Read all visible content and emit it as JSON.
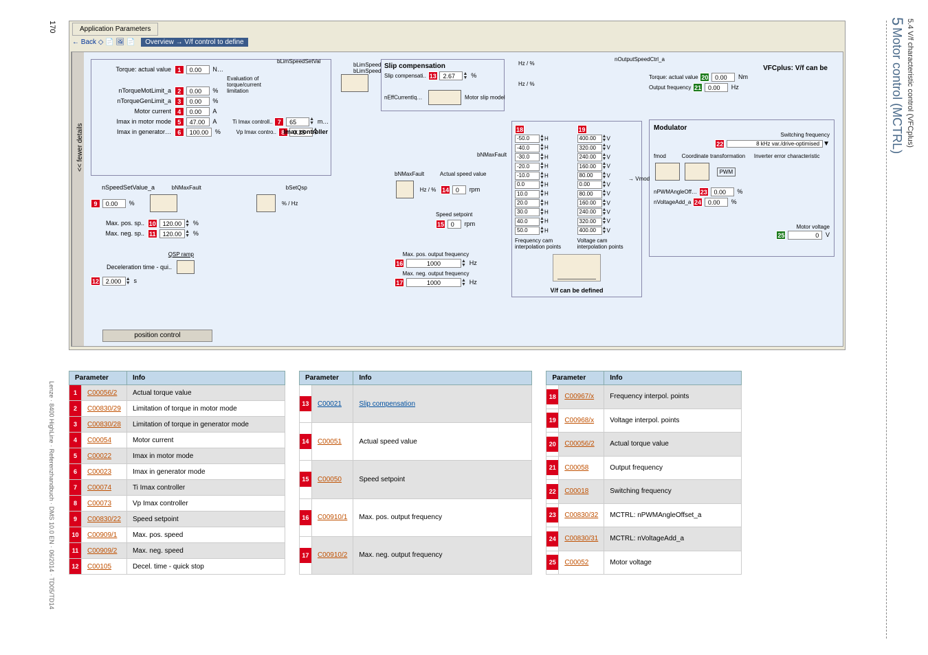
{
  "page_number": "170",
  "footer": "Lenze · 8400 HighLine · Referenzhandbuch · DMS 10.0 EN · 06/2014 · TD05/TD14",
  "chapter": {
    "num": "5",
    "title": "Motor control (MCTRL)"
  },
  "section": {
    "num": "5.4",
    "title": "V/f characteristic control (VFCplus)"
  },
  "tab": "Application Parameters",
  "toolbar": {
    "back": "← Back",
    "icons": "◇  📄 🖼 📄",
    "breadcrumb": "Overview → V/f control to define"
  },
  "fewer_details": "<< fewer details",
  "left_group": {
    "torque_actual": {
      "label": "Torque: actual value",
      "badge": "1",
      "value": "0.00",
      "unit": "N…"
    },
    "ntorquemot": {
      "label": "nTorqueMotLimit_a",
      "badge": "2",
      "value": "0.00",
      "unit": "%"
    },
    "ntorquegen": {
      "label": "nTorqueGenLimit_a",
      "badge": "3",
      "value": "0.00",
      "unit": "%"
    },
    "motor_current": {
      "label": "Motor current",
      "badge": "4",
      "value": "0.00",
      "unit": "A"
    },
    "imax_motor": {
      "label": "Imax in motor mode",
      "badge": "5",
      "value": "47.00",
      "unit": "A"
    },
    "imax_gen": {
      "label": "Imax in generator…",
      "badge": "6",
      "value": "100.00",
      "unit": "%"
    },
    "eval_label": "Evaluation of torque/current limitation",
    "ti_imax": {
      "label": "Ti Imax controll..",
      "badge": "7",
      "value": "65",
      "unit": "m…"
    },
    "vp_imax": {
      "label": "Vp Imax contro..",
      "badge": "8",
      "value": "0.25"
    },
    "imax_title": "Imax controller",
    "blimspeed": "bLimSpeedSetVal",
    "blim_setval": "bLimSpeedSetVal\nbLimSpeedSet Out"
  },
  "setvalue": {
    "nspeed": {
      "label": "nSpeedSetValue_a",
      "badge": "9",
      "value": "0.00",
      "unit": "%"
    },
    "bnmax": "bNMaxFault",
    "bsetqsp": "bSetQsp",
    "max_pos_sp": {
      "label": "Max. pos. sp..",
      "badge": "10",
      "value": "120.00",
      "unit": "%"
    },
    "max_neg_sp": {
      "label": "Max. neg. sp..",
      "badge": "11",
      "value": "120.00",
      "unit": "%"
    },
    "qsp_label": "QSP ramp",
    "decel": {
      "label": "Deceleration time - qui..",
      "badge": "12",
      "value": "2.000",
      "unit": "s"
    }
  },
  "slip": {
    "title": "Slip compensation",
    "comp": {
      "label": "Slip compensati..",
      "badge": "13",
      "value": "2.67",
      "unit": "%"
    },
    "neffcurrent": "nEffCurrentIq…",
    "motor_slip": "Motor slip model",
    "bnmax_fault": "bNMaxFault",
    "hz_pct": "Hz / %"
  },
  "actual_speed": {
    "bnmax": "bNMaxFault",
    "title": "Actual speed value",
    "badge14": "14",
    "value14": "0",
    "unit14": "rpm",
    "setpoint_title": "Speed setpoint",
    "badge15": "15",
    "value15": "0",
    "unit15": "rpm"
  },
  "max_freq": {
    "pos_label": "Max. pos. output frequency",
    "badge16": "16",
    "value16": "1000",
    "unit": "Hz",
    "neg_label": "Max. neg. output frequency",
    "badge17": "17",
    "value17": "1000"
  },
  "vf": {
    "badge18": "18",
    "badge19": "19",
    "hz_values": [
      "-50.0",
      "-40.0",
      "-30.0",
      "-20.0",
      "-10.0",
      "0.0",
      "10.0",
      "20.0",
      "30.0",
      "40.0",
      "50.0"
    ],
    "v_values": [
      "400.00",
      "320.00",
      "240.00",
      "160.00",
      "80.00",
      "0.00",
      "80.00",
      "160.00",
      "240.00",
      "320.00",
      "400.00"
    ],
    "freq_cam": "Frequency cam interpolation points",
    "volt_cam": "Voltage cam interpolation points",
    "bottom": "V/f can be defined",
    "H": "H",
    "V": "V"
  },
  "right": {
    "noutput": "nOutputSpeedCtrl_a",
    "vfc_title": "VFCplus: V/f can be",
    "torque_actual": {
      "label": "Torque: actual value",
      "badge": "20",
      "value": "0.00",
      "unit": "Nm"
    },
    "output_freq": {
      "label": "Output frequency",
      "badge": "21",
      "value": "0.00",
      "unit": "Hz"
    },
    "modulator": "Modulator",
    "sw_freq_label": "Switching frequency",
    "sw_freq_badge": "22",
    "sw_freq_value": "8 kHz var./drive-optimised",
    "fmod": "fmod",
    "coord": "Coordinate transformation",
    "inverter": "Inverter error characteristic",
    "pwm": "PWM",
    "npwm": {
      "label": "nPWMAngleOff…",
      "badge": "23",
      "value": "0.00",
      "unit": "%"
    },
    "nvolt": {
      "label": "nVoltageAdd_a",
      "badge": "24",
      "value": "0.00",
      "unit": "%"
    },
    "vmod": "Vmod",
    "motor_voltage_label": "Motor voltage",
    "motor_voltage_badge": "25",
    "motor_voltage_value": "0",
    "motor_voltage_unit": "V"
  },
  "position_control": "position control",
  "tables": {
    "headers": {
      "parameter": "Parameter",
      "info": "Info"
    },
    "t1": [
      {
        "n": "1",
        "code": "C00056/2",
        "info": "Actual torque value",
        "odd": true
      },
      {
        "n": "2",
        "code": "C00830/29",
        "info": "Limitation of torque in motor mode"
      },
      {
        "n": "3",
        "code": "C00830/28",
        "info": "Limitation of torque in generator mode",
        "odd": true
      },
      {
        "n": "4",
        "code": "C00054",
        "info": "Motor current"
      },
      {
        "n": "5",
        "code": "C00022",
        "info": "Imax in motor mode",
        "odd": true
      },
      {
        "n": "6",
        "code": "C00023",
        "info": "Imax in generator mode"
      },
      {
        "n": "7",
        "code": "C00074",
        "info": "Ti Imax controller",
        "odd": true
      },
      {
        "n": "8",
        "code": "C00073",
        "info": "Vp Imax controller"
      },
      {
        "n": "9",
        "code": "C00830/22",
        "info": "Speed setpoint",
        "odd": true
      },
      {
        "n": "10",
        "code": "C00909/1",
        "info": "Max. pos. speed"
      },
      {
        "n": "11",
        "code": "C00909/2",
        "info": "Max. neg. speed",
        "odd": true
      },
      {
        "n": "12",
        "code": "C00105",
        "info": "Decel. time - quick stop"
      }
    ],
    "t2": [
      {
        "n": "13",
        "code": "C00021",
        "info": "Slip compensation",
        "odd": true,
        "blue": true
      },
      {
        "n": "14",
        "code": "C00051",
        "info": "Actual speed value"
      },
      {
        "n": "15",
        "code": "C00050",
        "info": "Speed setpoint",
        "odd": true
      },
      {
        "n": "16",
        "code": "C00910/1",
        "info": "Max. pos. output frequency"
      },
      {
        "n": "17",
        "code": "C00910/2",
        "info": "Max. neg. output frequency",
        "odd": true
      }
    ],
    "t3": [
      {
        "n": "18",
        "code": "C00967/x",
        "info": "Frequency interpol. points",
        "odd": true
      },
      {
        "n": "19",
        "code": "C00968/x",
        "info": "Voltage interpol. points"
      },
      {
        "n": "20",
        "code": "C00056/2",
        "info": "Actual torque value",
        "odd": true
      },
      {
        "n": "21",
        "code": "C00058",
        "info": "Output frequency"
      },
      {
        "n": "22",
        "code": "C00018",
        "info": "Switching frequency",
        "odd": true
      },
      {
        "n": "23",
        "code": "C00830/32",
        "info": "MCTRL: nPWMAngleOffset_a"
      },
      {
        "n": "24",
        "code": "C00830/31",
        "info": "MCTRL: nVoltageAdd_a",
        "odd": true
      },
      {
        "n": "25",
        "code": "C00052",
        "info": "Motor voltage"
      }
    ]
  }
}
